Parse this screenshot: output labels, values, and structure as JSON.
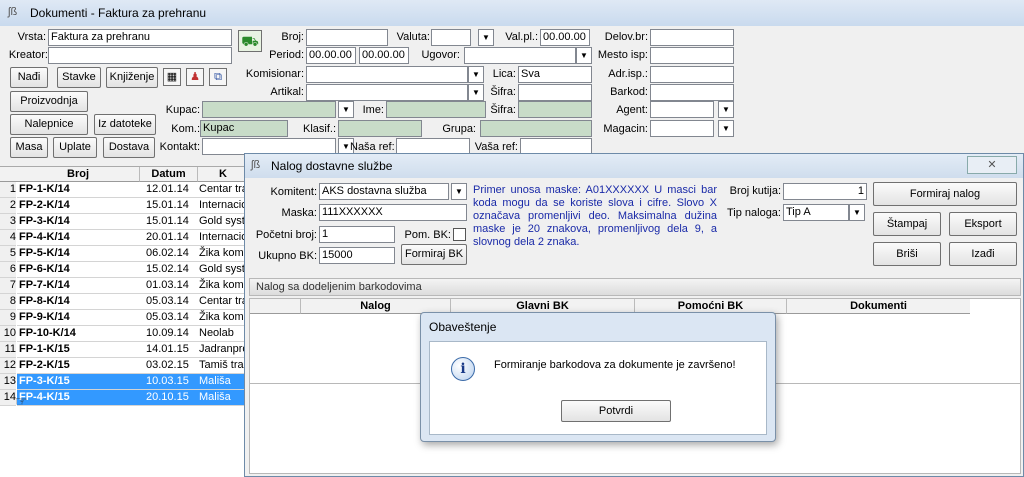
{
  "main": {
    "title": "Dokumenti - Faktura za prehranu",
    "labels": {
      "vrsta": "Vrsta:",
      "kreator": "Kreator:",
      "broj": "Broj:",
      "period": "Period:",
      "valuta": "Valuta:",
      "valpl": "Val.pl.:",
      "ugovor": "Ugovor:",
      "delovbr": "Delov.br:",
      "mestoisp": "Mesto isp:",
      "adrisp": "Adr.isp.:",
      "barkod": "Barkod:",
      "agent": "Agent:",
      "magacin": "Magacin:",
      "komisionar": "Komisionar:",
      "artikal": "Artikal:",
      "lica": "Lica:",
      "sifra1": "Šifra:",
      "sifra2": "Šifra:",
      "kupac": "Kupac:",
      "ime": "Ime:",
      "kom": "Kom.:",
      "klasif": "Klasif.:",
      "grupa": "Grupa:",
      "kontakt": "Kontakt:",
      "nasaref": "Naša ref:",
      "vasaref": "Vaša ref:"
    },
    "values": {
      "vrsta": "Faktura za prehranu",
      "period_from": "00.00.00",
      "period_to": "00.00.00",
      "valpl": "00.00.00",
      "lica": "Sva",
      "kom": "Kupac"
    },
    "buttons": {
      "nadji": "Nađi",
      "stavke": "Stavke",
      "knjizenje": "Knjiženje",
      "proizvodnja": "Proizvodnja",
      "nalepnice": "Nalepnice",
      "iz_datoteke": "Iz datoteke",
      "masa": "Masa",
      "uplate": "Uplate",
      "dostava": "Dostava"
    },
    "table": {
      "headers": [
        "Broj",
        "Datum",
        "K"
      ],
      "rows": [
        {
          "n": "1",
          "broj": "FP-1-K/14",
          "datum": "12.01.14",
          "k": "Centar tra"
        },
        {
          "n": "2",
          "broj": "FP-2-K/14",
          "datum": "15.01.14",
          "k": "Internacio"
        },
        {
          "n": "3",
          "broj": "FP-3-K/14",
          "datum": "15.01.14",
          "k": "Gold syste"
        },
        {
          "n": "4",
          "broj": "FP-4-K/14",
          "datum": "20.01.14",
          "k": "Internacio"
        },
        {
          "n": "5",
          "broj": "FP-5-K/14",
          "datum": "06.02.14",
          "k": "Žika komi"
        },
        {
          "n": "6",
          "broj": "FP-6-K/14",
          "datum": "15.02.14",
          "k": "Gold syste"
        },
        {
          "n": "7",
          "broj": "FP-7-K/14",
          "datum": "01.03.14",
          "k": "Žika komi"
        },
        {
          "n": "8",
          "broj": "FP-8-K/14",
          "datum": "05.03.14",
          "k": "Centar tra"
        },
        {
          "n": "9",
          "broj": "FP-9-K/14",
          "datum": "05.03.14",
          "k": "Žika komi"
        },
        {
          "n": "10",
          "broj": "FP-10-K/14",
          "datum": "10.09.14",
          "k": "Neolab"
        },
        {
          "n": "11",
          "broj": "FP-1-K/15",
          "datum": "14.01.15",
          "k": "Jadranpro"
        },
        {
          "n": "12",
          "broj": "FP-2-K/15",
          "datum": "03.02.15",
          "k": "Tamiš trac"
        },
        {
          "n": "13",
          "broj": "FP-3-K/15",
          "datum": "10.03.15",
          "k": "Mališa"
        },
        {
          "n": "14",
          "broj": "FP-4-K/15",
          "datum": "20.10.15",
          "k": "Mališa"
        }
      ]
    }
  },
  "nalog": {
    "title": "Nalog dostavne službe",
    "labels": {
      "komitent": "Komitent:",
      "maska": "Maska:",
      "pocetni": "Početni broj:",
      "pombk": "Pom. BK:",
      "ukupnobk": "Ukupno BK:",
      "brojkutija": "Broj kutija:",
      "tipnaloga": "Tip naloga:"
    },
    "values": {
      "komitent": "AKS dostavna služba",
      "maska": "111XXXXXX",
      "pocetni": "1",
      "ukupnobk": "15000",
      "brojkutija": "1",
      "tipnaloga": "Tip A"
    },
    "hint": "Primer unosa maske: A01XXXXXX  U masci bar koda mogu da se koriste slova i cifre. Slovo X označava promenljivi deo. Maksimalna dužina maske je 20 znakova, promenljivog dela 9, a slovnog dela 2 znaka.",
    "buttons": {
      "formiraj_bk": "Formiraj BK",
      "formiraj_nalog": "Formiraj nalog",
      "stampaj": "Štampaj",
      "eksport": "Eksport",
      "brisi": "Briši",
      "izadji": "Izađi"
    },
    "section": "Nalog sa dodeljenim barkodovima",
    "columns": [
      "Nalog",
      "Glavni BK",
      "Pomoćni BK",
      "Dokumenti"
    ]
  },
  "dialog": {
    "title": "Obaveštenje",
    "message": "Formiranje barkodova za dokumente je završeno!",
    "ok": "Potvrdi"
  }
}
